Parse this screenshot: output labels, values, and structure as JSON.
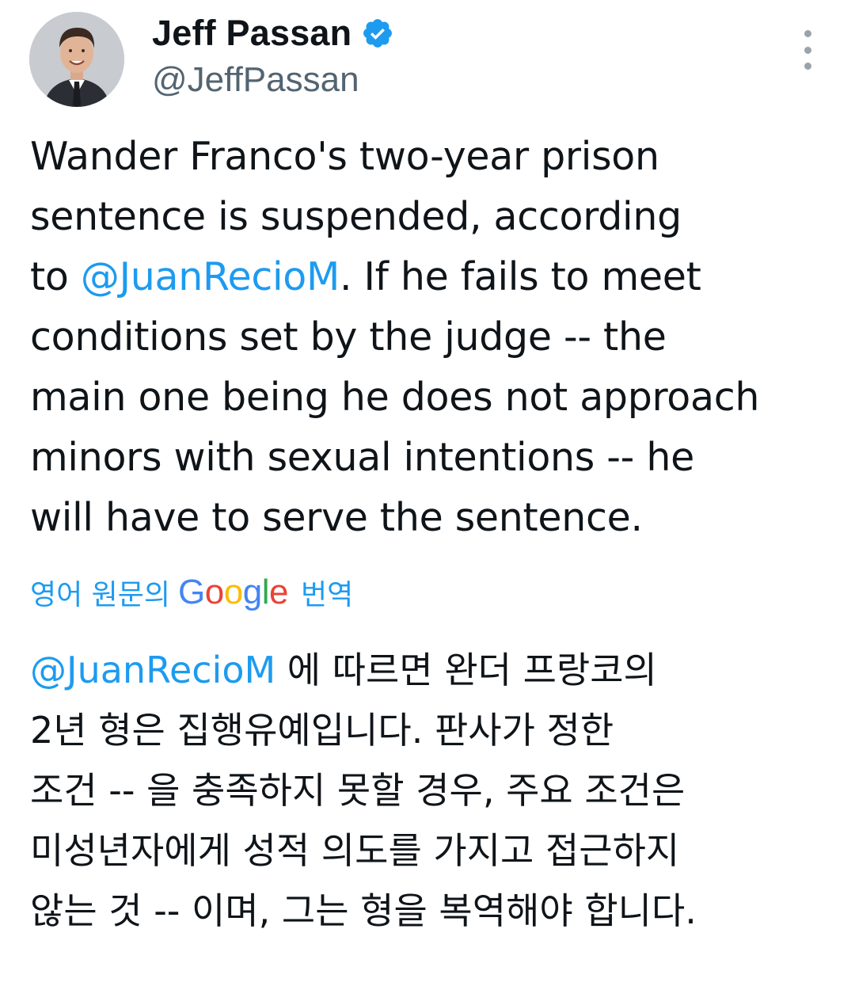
{
  "author": {
    "name": "Jeff Passan",
    "handle": "@JeffPassan",
    "verified": true
  },
  "tweet": {
    "lines": [
      {
        "segments": [
          {
            "text": "Wander Franco's two-year prison",
            "mention": false
          }
        ]
      },
      {
        "segments": [
          {
            "text": "sentence is suspended, according",
            "mention": false
          }
        ]
      },
      {
        "segments": [
          {
            "text": "to ",
            "mention": false
          },
          {
            "text": "@JuanRecioM",
            "mention": true
          },
          {
            "text": ". If he fails to meet",
            "mention": false
          }
        ]
      },
      {
        "segments": [
          {
            "text": "conditions set by the judge -- the",
            "mention": false
          }
        ]
      },
      {
        "segments": [
          {
            "text": "main one being he does not approach",
            "mention": false
          }
        ]
      },
      {
        "segments": [
          {
            "text": "minors with sexual intentions -- he",
            "mention": false
          }
        ]
      },
      {
        "segments": [
          {
            "text": "will have to serve the sentence.",
            "mention": false
          }
        ]
      }
    ]
  },
  "translation": {
    "label": "영어 원문의",
    "provider": "Google",
    "suffix": "번역",
    "lines": [
      {
        "segments": [
          {
            "text": "@JuanRecioM",
            "mention": true
          },
          {
            "text": " 에 따르면 완더 프랑코의",
            "mention": false
          }
        ]
      },
      {
        "segments": [
          {
            "text": "2년 형은 집행유예입니다. 판사가 정한",
            "mention": false
          }
        ]
      },
      {
        "segments": [
          {
            "text": "조건 -- 을 충족하지 못할 경우, 주요 조건은",
            "mention": false
          }
        ]
      },
      {
        "segments": [
          {
            "text": "미성년자에게 성적 의도를 가지고 접근하지",
            "mention": false
          }
        ]
      },
      {
        "segments": [
          {
            "text": "않는 것 -- 이며, 그는 형을 복역해야 합니다.",
            "mention": false
          }
        ]
      }
    ]
  },
  "colors": {
    "link": "#1d9bf0",
    "text": "#0f1419",
    "secondary": "#536471",
    "verified_badge": "#1d9bf0"
  },
  "icons": [
    "avatar-photo",
    "verified-badge-icon",
    "more-options-icon",
    "google-logo"
  ]
}
